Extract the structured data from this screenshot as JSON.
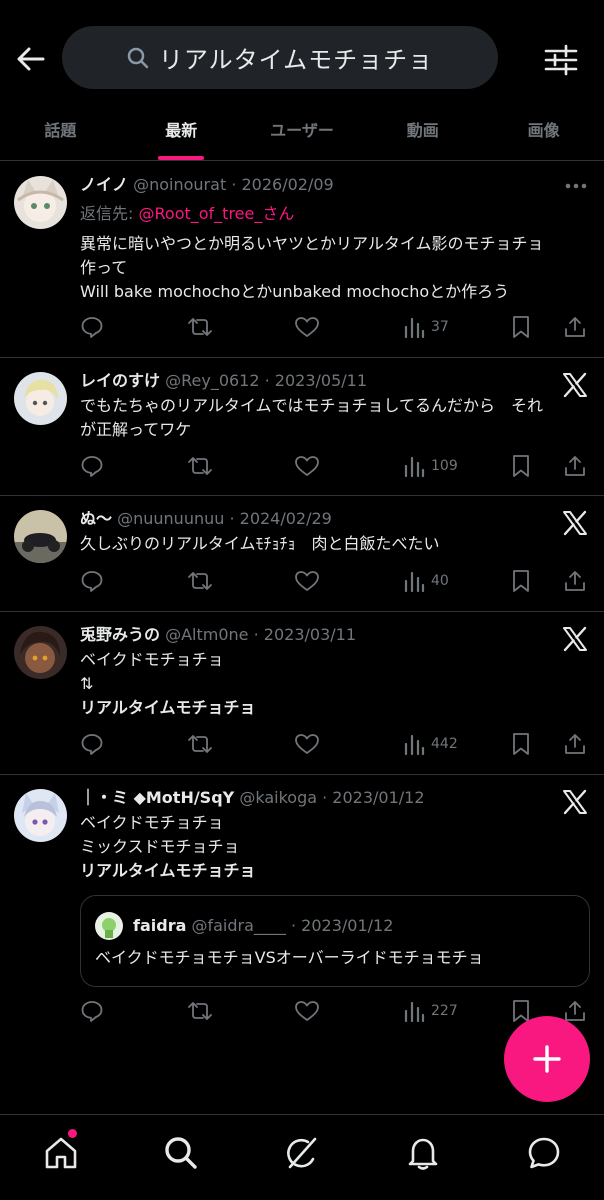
{
  "search": {
    "query": "リアルタイムモチョチョ"
  },
  "tabs": [
    {
      "label": "話題"
    },
    {
      "label": "最新"
    },
    {
      "label": "ユーザー"
    },
    {
      "label": "動画"
    },
    {
      "label": "画像"
    }
  ],
  "active_tab": "最新",
  "accent_color": "#f91880",
  "posts": [
    {
      "name": "ノイノ",
      "meta": "@noinourat · 2026/02/09",
      "reply_prefix": "返信先:",
      "reply_handle": "@Root_of_tree_さん",
      "lines": [
        {
          "text": "異常に暗いやつとか明るいヤツとかリアルタイム影のモチョチョ"
        },
        {
          "text": "作って"
        },
        {
          "text": "Will bake mochochoとかunbaked mochochoとか作ろう"
        }
      ],
      "views": "37",
      "badge": "more-icon"
    },
    {
      "name": "レイのすけ",
      "meta": "@Rey_0612 · 2023/05/11",
      "lines": [
        {
          "text": "でもたちゃのリアルタイムではモチョチョしてるんだから　それ"
        },
        {
          "text": "が正解ってワケ"
        }
      ],
      "views": "109",
      "badge": "x-logo-icon"
    },
    {
      "name": "ぬ〜",
      "meta": "@nuunuunuu · 2024/02/29",
      "lines": [
        {
          "text": "久しぶりのリアルタイムﾓﾁｮﾁｮ　肉と白飯たべたい"
        }
      ],
      "views": "40",
      "badge": "x-logo-icon"
    },
    {
      "name": "兎野みうの",
      "meta": "@Altm0ne · 2023/03/11",
      "lines": [
        {
          "text": "ベイクドモチョチョ"
        },
        {
          "text": "⇅"
        },
        {
          "text": "リアルタイムモチョチョ",
          "strong": true
        }
      ],
      "views": "442",
      "badge": "x-logo-icon"
    },
    {
      "name": "｜・ミ ◆MotH/SqY",
      "meta": "@kaikoga · 2023/01/12",
      "lines": [
        {
          "text": "ベイクドモチョチョ"
        },
        {
          "text": "ミックスドモチョチョ"
        },
        {
          "text": "リアルタイムモチョチョ",
          "strong": true
        }
      ],
      "quote": {
        "name": "faidra",
        "meta": "@faidra____ · 2023/01/12",
        "text": "ベイクドモチョモチョVSオーバーライドモチョモチョ"
      },
      "views": "227",
      "badge": "x-logo-icon"
    }
  ],
  "fab": {
    "icon": "plus-icon"
  },
  "bottom_nav": [
    {
      "icon": "home-icon"
    },
    {
      "icon": "search-icon"
    },
    {
      "icon": "grok-icon"
    },
    {
      "icon": "bell-icon"
    },
    {
      "icon": "chat-icon"
    }
  ]
}
